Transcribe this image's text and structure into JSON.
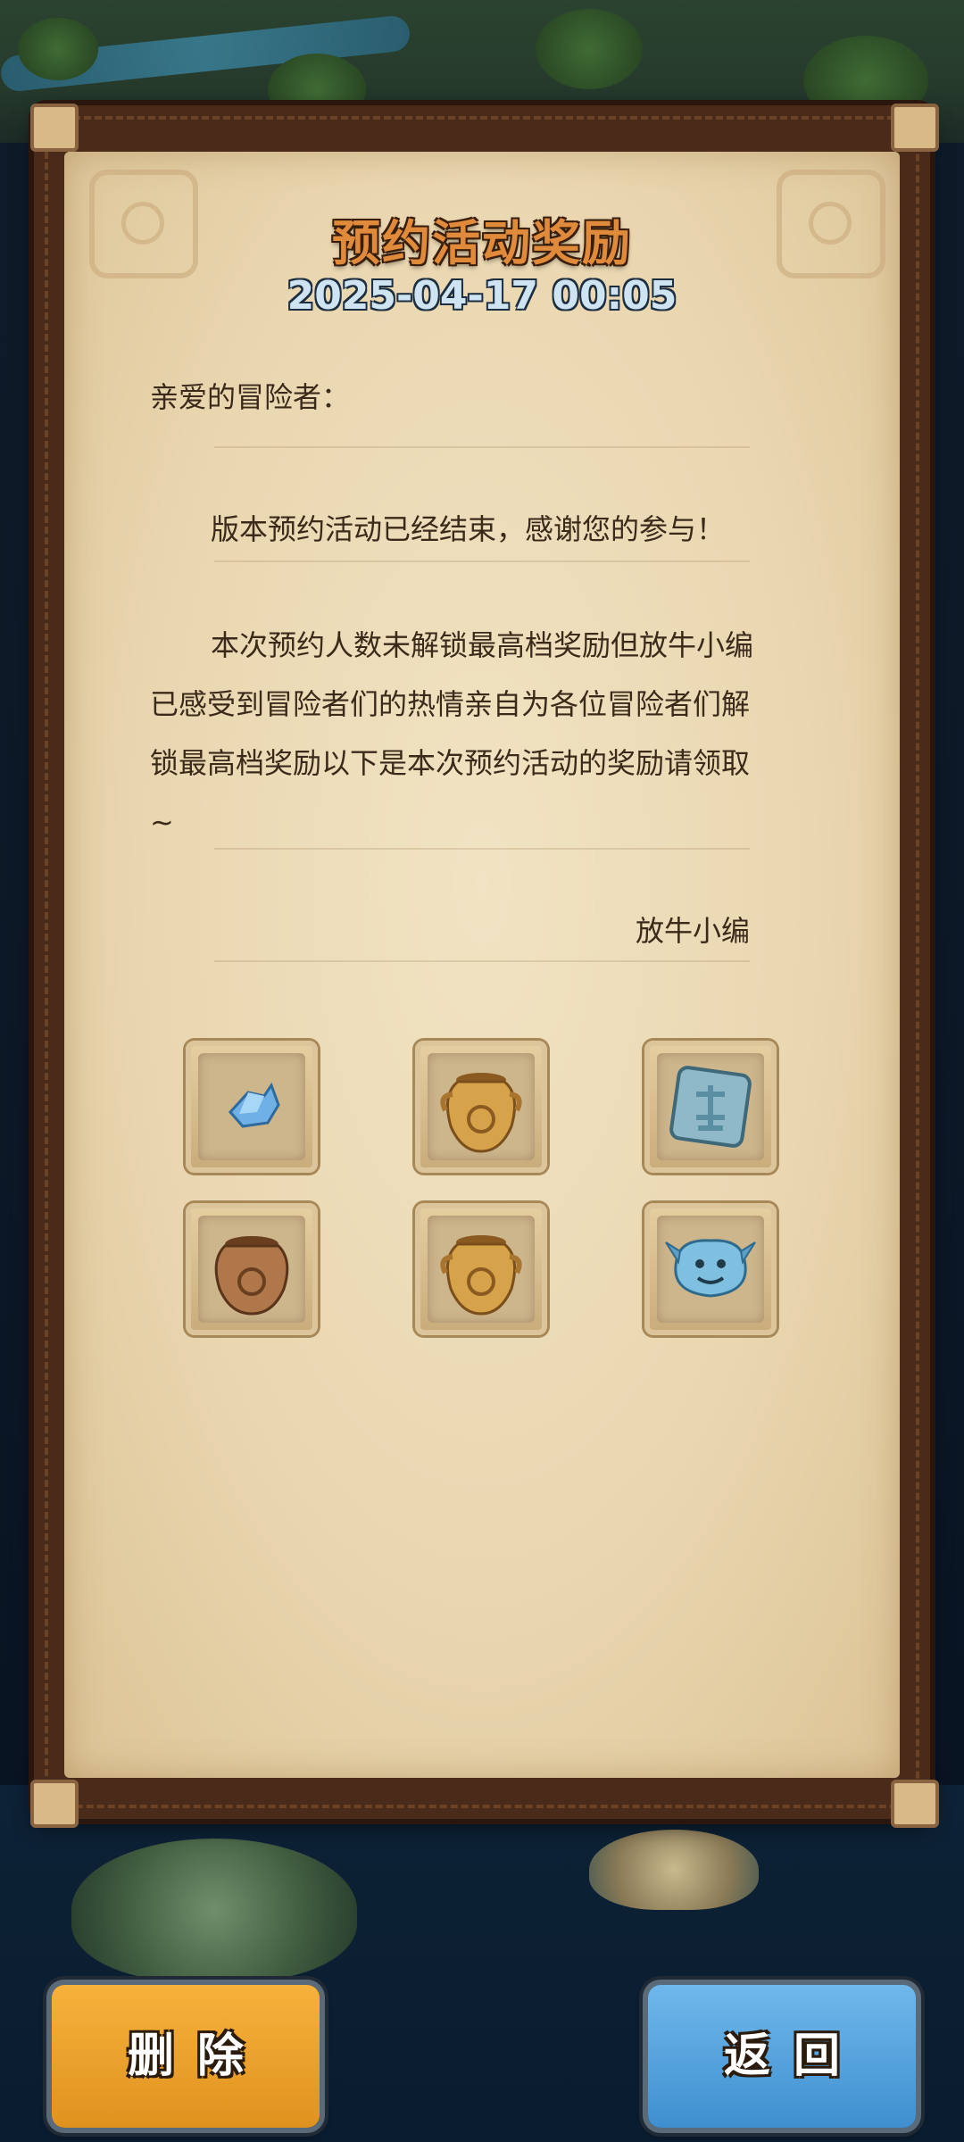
{
  "letter": {
    "title": "预约活动奖励",
    "date": "2025-04-17 00:05",
    "greeting": "亲爱的冒险者：",
    "paragraph1": "版本预约活动已经结束，感谢您的参与！",
    "paragraph2": "本次预约人数未解锁最高档奖励但放牛小编已感受到冒险者们的热情亲自为各位冒险者们解锁最高档奖励以下是本次预约活动的奖励请领取~",
    "signature": "放牛小编"
  },
  "rewards": [
    {
      "icon": "blue-crystal-icon"
    },
    {
      "icon": "golden-jar-icon"
    },
    {
      "icon": "rune-stone-icon"
    },
    {
      "icon": "bronze-jar-icon"
    },
    {
      "icon": "golden-jar-icon"
    },
    {
      "icon": "blue-slime-icon"
    }
  ],
  "buttons": {
    "delete_label": "删除",
    "back_label": "返回"
  },
  "colors": {
    "delete_button": "#f2a531",
    "back_button": "#5aa7e0",
    "title": "#e08a3c",
    "paper": "#ecdbb6"
  }
}
